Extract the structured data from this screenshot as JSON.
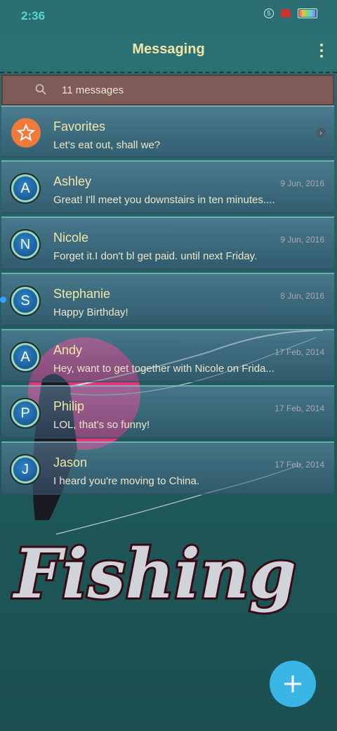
{
  "status_bar": {
    "time": "2:36",
    "badge": "5"
  },
  "header": {
    "title": "Messaging"
  },
  "search": {
    "text": "11 messages"
  },
  "threads": [
    {
      "name": "Favorites",
      "preview": "Let's eat out, shall we?",
      "date": "",
      "avatar": ""
    },
    {
      "name": "Ashley",
      "preview": "Great! I'll meet you downstairs in ten minutes....",
      "date": "9 Jun, 2016",
      "avatar": "A"
    },
    {
      "name": "Nicole",
      "preview": "Forget it.I don't bl get paid. until next Friday.",
      "date": "9 Jun, 2016",
      "avatar": "N"
    },
    {
      "name": "Stephanie",
      "preview": "Happy Birthday!",
      "date": "8 Jun, 2016",
      "avatar": "S"
    },
    {
      "name": "Andy",
      "preview": "Hey, want to get together with Nicole on Frida...",
      "date": "17 Feb, 2014",
      "avatar": "A"
    },
    {
      "name": "Philip",
      "preview": "LOL, that's so funny!",
      "date": "17 Feb, 2014",
      "avatar": "P"
    },
    {
      "name": "Jason",
      "preview": "I heard you're moving to China.",
      "date": "17 Feb, 2014",
      "avatar": "J"
    }
  ],
  "wallpaper": {
    "text": "Fishing"
  },
  "colors": {
    "accent": "#3ab6e6",
    "title": "#f2e6a8",
    "favorite": "#f07a3a"
  }
}
